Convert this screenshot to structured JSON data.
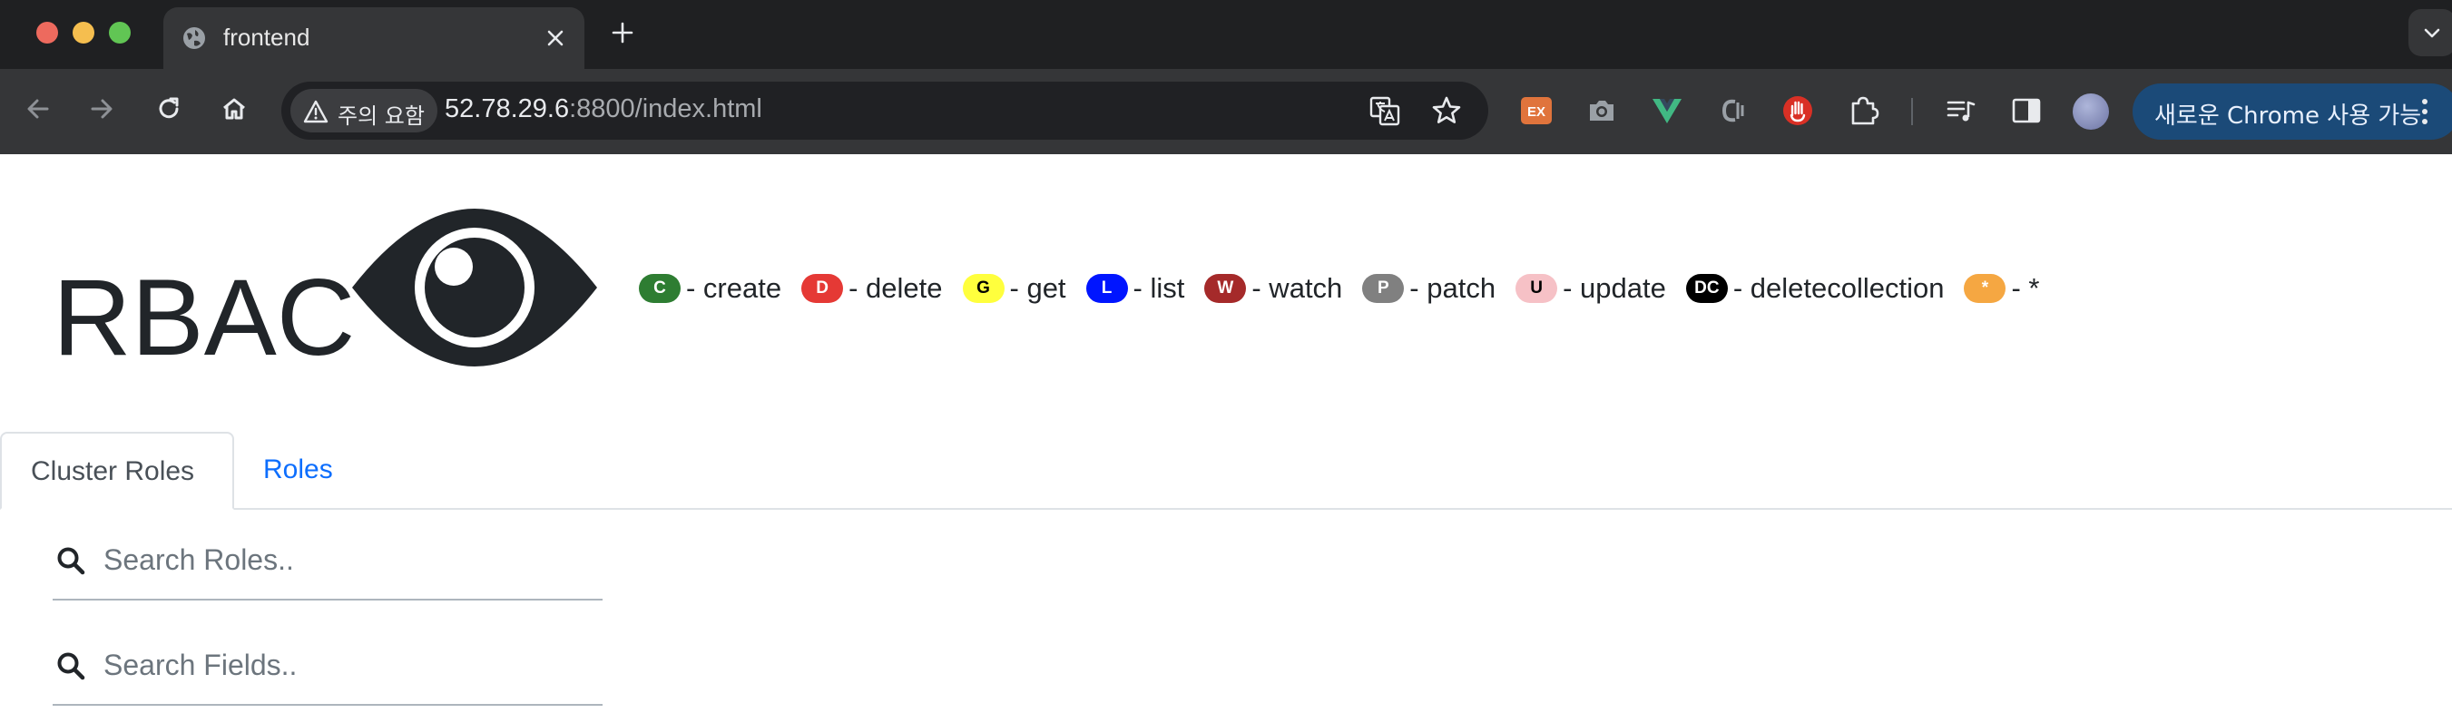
{
  "browser": {
    "tab_title": "frontend",
    "security_label": "주의 요함",
    "url_host": "52.78.29.6",
    "url_rest": ":8800/index.html",
    "update_label": "새로운 Chrome 사용 가능",
    "extension_ex_label": "EX"
  },
  "page": {
    "title": "RBAC",
    "legend": [
      {
        "badge": "C",
        "label": "- create",
        "color": "#2e7d32",
        "text_color": "#ffffff"
      },
      {
        "badge": "D",
        "label": "- delete",
        "color": "#e53935",
        "text_color": "#ffffff"
      },
      {
        "badge": "G",
        "label": "- get",
        "color": "#ffff3d",
        "text_color": "#000000"
      },
      {
        "badge": "L",
        "label": "- list",
        "color": "#0015ff",
        "text_color": "#ffffff"
      },
      {
        "badge": "W",
        "label": "- watch",
        "color": "#a52a2a",
        "text_color": "#ffffff"
      },
      {
        "badge": "P",
        "label": "- patch",
        "color": "#808080",
        "text_color": "#ffffff"
      },
      {
        "badge": "U",
        "label": "- update",
        "color": "#f6c1c6",
        "text_color": "#000000"
      },
      {
        "badge": "DC",
        "label": "- deletecollection",
        "color": "#000000",
        "text_color": "#ffffff"
      },
      {
        "badge": "*",
        "label": "- *",
        "color": "#f5a742",
        "text_color": "#ffffff"
      }
    ],
    "tabs": [
      {
        "label": "Cluster Roles",
        "active": true
      },
      {
        "label": "Roles",
        "active": false
      }
    ],
    "search_roles_placeholder": "Search Roles..",
    "search_fields_placeholder": "Search Fields.."
  }
}
